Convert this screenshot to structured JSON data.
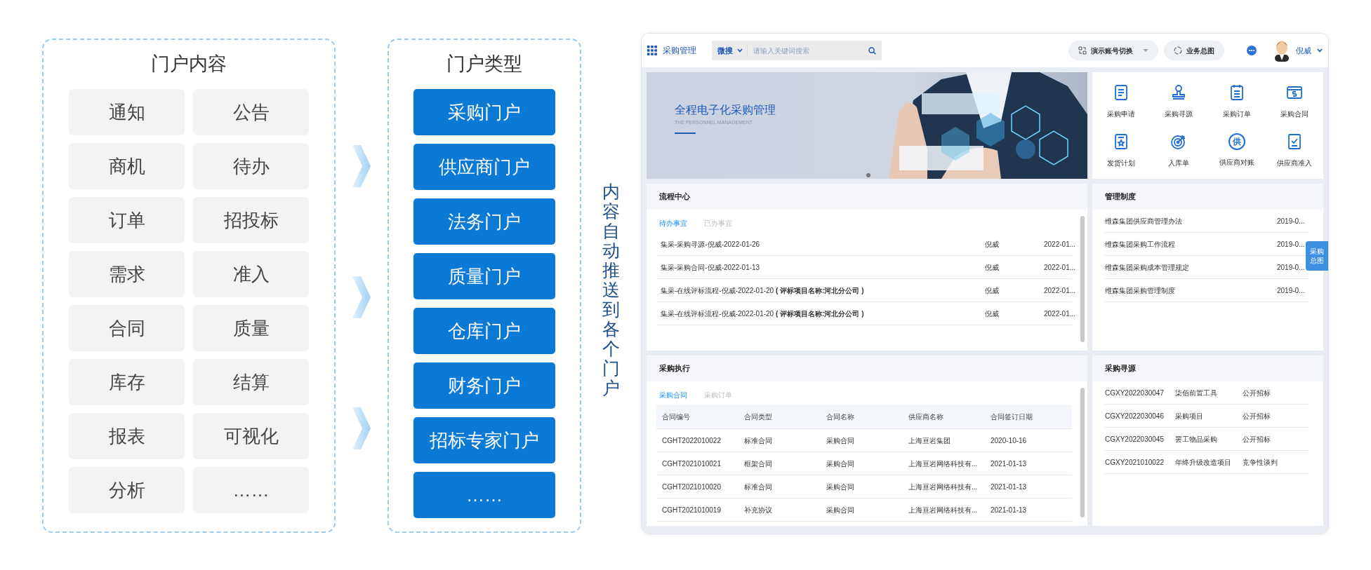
{
  "portal_content": {
    "title": "门户内容",
    "items": [
      "通知",
      "公告",
      "商机",
      "待办",
      "订单",
      "招投标",
      "需求",
      "准入",
      "合同",
      "质量",
      "库存",
      "结算",
      "报表",
      "可视化",
      "分析",
      "……"
    ]
  },
  "portal_types": {
    "title": "门户类型",
    "items": [
      "采购门户",
      "供应商门户",
      "法务门户",
      "质量门户",
      "仓库门户",
      "财务门户",
      "招标专家门户",
      "……"
    ]
  },
  "push_label": "内容自动推送到各个门户",
  "app": {
    "app_name": "采购管理",
    "search": {
      "scope": "微搜",
      "placeholder": "请输入关键词搜索"
    },
    "header_buttons": [
      {
        "label": "演示账号切换",
        "kind": "switch"
      },
      {
        "label": "业务总图",
        "kind": "overview"
      }
    ],
    "user": "倪威",
    "banner": {
      "title": "全程电子化采购管理",
      "subtitle": "THE PERSONNEL MANAGEMENT"
    },
    "shortcuts": [
      {
        "label": "采购申请",
        "kind": "document"
      },
      {
        "label": "采购寻源",
        "kind": "stamp"
      },
      {
        "label": "采购订单",
        "kind": "notepad"
      },
      {
        "label": "采购合同",
        "kind": "payment"
      },
      {
        "label": "发货计划",
        "kind": "plan"
      },
      {
        "label": "入库单",
        "kind": "target"
      },
      {
        "label": "供应商对账",
        "kind": "glyph",
        "glyph": "供"
      },
      {
        "label": "供应商准入",
        "kind": "checklist"
      }
    ],
    "process_center": {
      "title": "流程中心",
      "tabs": [
        {
          "label": "待办事宜",
          "selected": true
        },
        {
          "label": "已办事宜",
          "selected": false
        }
      ],
      "rows": [
        {
          "title": "集采-采购寻源-倪威-2022-01-26",
          "person": "倪威",
          "date": "2022-01..."
        },
        {
          "title": "集采-采购合同-倪威-2022-01-13",
          "person": "倪威",
          "date": "2022-01..."
        },
        {
          "title": "集采-在线评标流程-倪威-2022-01-20 **( 评标项目名称:河北分公司 )**",
          "person": "倪威",
          "date": "2022-01..."
        },
        {
          "title": "集采-在线评标流程-倪威-2022-01-20 **( 评标项目名称:河北分公司 )**",
          "person": "倪威",
          "date": "2022-01..."
        }
      ]
    },
    "regulations": {
      "title": "管理制度",
      "rows": [
        {
          "name": "维森集团供应商管理办法",
          "date": "2019-0..."
        },
        {
          "name": "维森集团采购工作流程",
          "date": "2019-0..."
        },
        {
          "name": "维森集团采购成本管理规定",
          "date": "2019-0..."
        },
        {
          "name": "维森集团采购管理制度",
          "date": "2019-0..."
        }
      ]
    },
    "float_button": "采购总图",
    "execution": {
      "title": "采购执行",
      "tabs": [
        {
          "label": "采购合同",
          "selected": true
        },
        {
          "label": "采购订单",
          "selected": false
        }
      ],
      "columns": [
        "合同编号",
        "合同类型",
        "合同名称",
        "供应商名称",
        "合同签订日期"
      ],
      "rows": [
        [
          "CGHT2022010022",
          "标准合同",
          "采购合同",
          "上海亘岩集团",
          "2020-10-16"
        ],
        [
          "CGHT2021010021",
          "框架合同",
          "采购合同",
          "上海亘岩网络科技有...",
          "2021-01-13"
        ],
        [
          "CGHT2021010020",
          "标准合同",
          "采购合同",
          "上海亘岩网络科技有...",
          "2021-01-13"
        ],
        [
          "CGHT2021010019",
          "补充协议",
          "采购合同",
          "上海亘岩网络科技有...",
          "2021-01-13"
        ]
      ]
    },
    "sourcing": {
      "title": "采购寻源",
      "rows": [
        [
          "CGXY2022030047",
          "柒佰前置工具",
          "公开招标"
        ],
        [
          "CGXY2022030046",
          "采购项目",
          "公开招标"
        ],
        [
          "CGXY2022030045",
          "罢工物品采购",
          "公开招标"
        ],
        [
          "CGXY2021010022",
          "年终升级改造项目",
          "竞争性谈判"
        ]
      ]
    }
  }
}
